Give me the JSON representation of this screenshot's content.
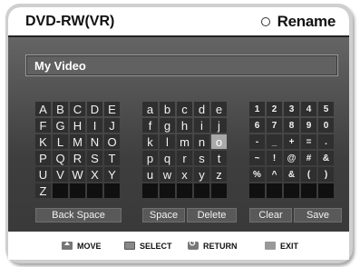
{
  "header": {
    "title": "DVD-RW(VR)",
    "rename": "Rename",
    "rename_icon": "circle-icon"
  },
  "name_field": {
    "value": "My Video"
  },
  "keyboard": {
    "upper": [
      "A",
      "B",
      "C",
      "D",
      "E",
      "F",
      "G",
      "H",
      "I",
      "J",
      "K",
      "L",
      "M",
      "N",
      "O",
      "P",
      "Q",
      "R",
      "S",
      "T",
      "U",
      "V",
      "W",
      "X",
      "Y",
      "Z",
      "",
      "",
      "",
      ""
    ],
    "lower": [
      "a",
      "b",
      "c",
      "d",
      "e",
      "f",
      "g",
      "h",
      "i",
      "j",
      "k",
      "l",
      "m",
      "n",
      "o",
      "p",
      "q",
      "r",
      "s",
      "t",
      "u",
      "w",
      "x",
      "y",
      "z",
      "",
      "",
      "",
      "",
      ""
    ],
    "symbols": [
      "1",
      "2",
      "3",
      "4",
      "5",
      "6",
      "7",
      "8",
      "9",
      "0",
      "-",
      "_",
      "+",
      "=",
      ".",
      "~",
      "!",
      "@",
      "#",
      "&",
      "%",
      "^",
      "&",
      "(",
      ")",
      "",
      "",
      "",
      "",
      ""
    ],
    "selected": "o"
  },
  "functions": {
    "backspace": "Back Space",
    "space": "Space",
    "delete": "Delete",
    "clear": "Clear",
    "save": "Save"
  },
  "footer": {
    "move": "MOVE",
    "select": "SELECT",
    "return": "RETURN",
    "exit": "EXIT"
  }
}
